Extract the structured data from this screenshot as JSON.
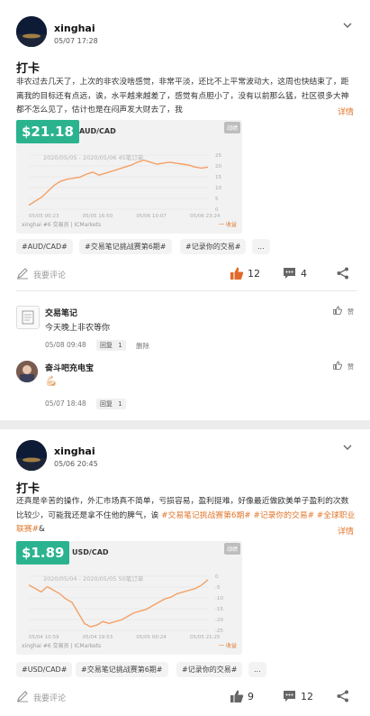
{
  "posts": [
    {
      "user": "xinghai",
      "time": "05/07 17:28",
      "title": "打卡",
      "body_text": "非农过去几天了，上次的非农没啥感觉，非常平淡，还比不上平常波动大，这周也快结束了，距离我的目标还有点远，诶，水平越来越差了，感觉有点胆小了，没有以前那么猛，社区很多大神都不怎么见了，估计也是在闷声发大财去了，我",
      "body_tags": [],
      "more": "详情",
      "card": {
        "price": "$21.18",
        "pair": "AUD/CAD",
        "badge": "战绩",
        "range_label": "2020/05/05 - 2020/05/06 45笔订单",
        "x_labels": [
          "05/05 00:23",
          "05/05 16:50",
          "05/06 10:07",
          "05/06 23:24"
        ],
        "y_labels": [
          "25",
          "20",
          "15",
          "10",
          "5",
          "0"
        ],
        "footer_left": "xinghai #6    交易员 | ICMarkets",
        "footer_right": "一 收益",
        "chart_data": {
          "type": "line",
          "x": [
            "05/05 00:23",
            "05/05 16:50",
            "05/06 10:07",
            "05/06 23:24"
          ],
          "values": [
            2,
            4,
            6,
            9,
            12,
            14,
            15,
            15.5,
            16,
            17.5,
            18.5,
            17,
            18,
            19,
            20,
            21,
            22,
            23.5,
            24.5,
            23.5,
            22.5,
            23,
            23.5,
            23,
            22.5,
            22,
            21,
            20.5,
            21
          ],
          "ylim": [
            0,
            27
          ]
        }
      },
      "chips": [
        "#AUD/CAD#",
        "#交易笔记挑战赛第6期#",
        "#记录你的交易#",
        "..."
      ],
      "comment_placeholder": "我要评论",
      "likes": "12",
      "comments": "4",
      "replies": [
        {
          "name": "交易笔记",
          "text": "今天晚上非农等你",
          "time": "05/08 09:48",
          "reply_label": "回复",
          "reply_count": "1",
          "delete_label": "删除",
          "like_label": "赞"
        },
        {
          "name": "奋斗吧充电宝",
          "text": "💪🏻",
          "time": "05/07 18:48",
          "reply_label": "回复",
          "reply_count": "1",
          "like_label": "赞"
        }
      ]
    },
    {
      "user": "xinghai",
      "time": "05/06 20:45",
      "title": "打卡",
      "body_text": "还真是辛苦的操作，外汇市场真不简单，亏损容易，盈利挺难，好像最近做欧美单子盈利的次数比较少，可能我还是拿不住他的脾气，诶 ",
      "body_tags": [
        "#交易笔记挑战赛第6期#",
        " #记录你的交易#",
        " #全球职业联赛#",
        "&"
      ],
      "more": "详情",
      "card": {
        "price": "$1.89",
        "pair": "USD/CAD",
        "badge": "战绩",
        "range_label": "2020/05/04 - 2020/05/05 50笔订单",
        "x_labels": [
          "05/04 10:59",
          "05/04 19:53",
          "05/05 00:24",
          "05/05 21:25"
        ],
        "y_labels": [
          "0",
          "-5",
          "-10",
          "-15",
          "-20",
          "-25"
        ],
        "footer_left": "xinghai #6    交易员 | ICMarkets",
        "footer_right": "一 收益",
        "chart_data": {
          "type": "line",
          "x": [
            "05/04 10:59",
            "05/04 19:53",
            "05/05 00:24",
            "05/05 21:25"
          ],
          "values": [
            -2,
            -4,
            -6,
            -3,
            -5,
            -7,
            -10,
            -12,
            -18,
            -24,
            -26,
            -25,
            -23,
            -24,
            -23,
            -22,
            -20,
            -18,
            -17,
            -16,
            -14,
            -12,
            -10,
            -9,
            -7,
            -6,
            -5,
            -4,
            -2,
            1
          ],
          "ylim": [
            -28,
            3
          ]
        }
      },
      "chips": [
        "#USD/CAD#",
        "#交易笔记挑战赛第6期#",
        "#记录你的交易#",
        "..."
      ],
      "comment_placeholder": "我要评论",
      "likes": "9",
      "comments": "12"
    }
  ],
  "colors": {
    "accent": "#e0752a",
    "price_bg": "#2bb38f",
    "line": "#f4a064"
  }
}
